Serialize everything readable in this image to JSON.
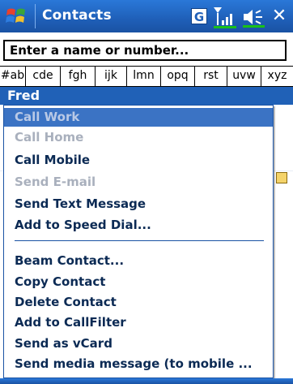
{
  "titlebar": {
    "title": "Contacts",
    "g_label": "G"
  },
  "search": {
    "placeholder": "Enter a name or number..."
  },
  "alpha_tabs": [
    "#ab",
    "cde",
    "fgh",
    "ijk",
    "lmn",
    "opq",
    "rst",
    "uvw",
    "xyz"
  ],
  "contact": {
    "name": "Fred"
  },
  "menu": {
    "items": [
      {
        "label": "Call Work",
        "state": "highlight"
      },
      {
        "label": "Call Home",
        "state": "disabled"
      },
      {
        "label": "Call Mobile",
        "state": "enabled"
      },
      {
        "label": "Send E-mail",
        "state": "disabled"
      },
      {
        "label": "Send Text Message",
        "state": "enabled"
      },
      {
        "label": "Add to Speed Dial...",
        "state": "enabled"
      },
      {
        "label": "Beam Contact...",
        "state": "enabled"
      },
      {
        "label": "Copy Contact",
        "state": "enabled"
      },
      {
        "label": "Delete Contact",
        "state": "enabled"
      },
      {
        "label": "Add to CallFilter",
        "state": "enabled"
      },
      {
        "label": "Send as vCard",
        "state": "enabled"
      },
      {
        "label": "Send media message (to mobile ...",
        "state": "enabled"
      }
    ]
  },
  "colors": {
    "titlebar": "#1f5fb8",
    "accent": "#2061b7",
    "menu_text": "#0b2a54",
    "disabled": "#a9b0bd"
  },
  "icons": [
    "windows-start-icon",
    "g-icon",
    "signal-icon",
    "volume-icon",
    "close-icon"
  ]
}
